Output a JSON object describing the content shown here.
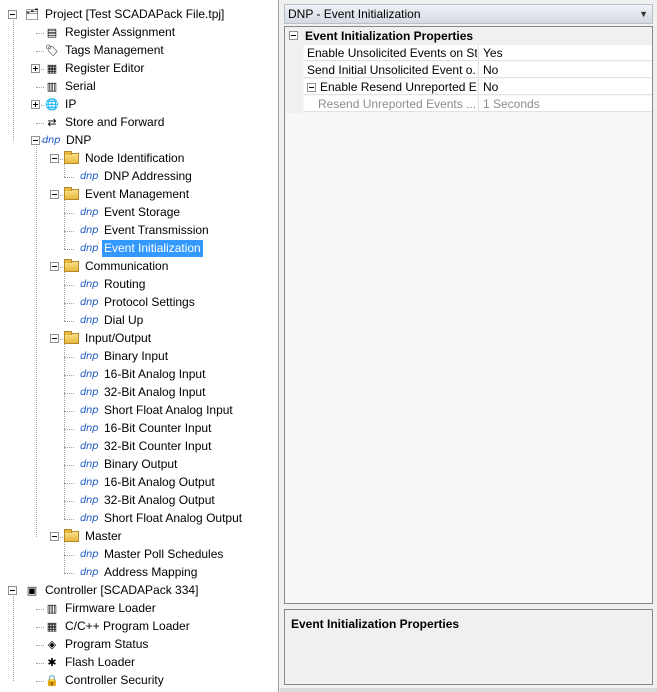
{
  "tree": {
    "items": [
      {
        "label": "Project [Test SCADAPack File.tpj]",
        "icon": "project-icon",
        "expander": "expanded",
        "depth": 0
      },
      {
        "label": "Register Assignment",
        "icon": "register-assignment-icon",
        "depth": 1
      },
      {
        "label": "Tags Management",
        "icon": "tag-icon",
        "depth": 1
      },
      {
        "label": "Register Editor",
        "icon": "register-editor-icon",
        "expander": "collapsed",
        "depth": 1
      },
      {
        "label": "Serial",
        "icon": "serial-icon",
        "depth": 1
      },
      {
        "label": "IP",
        "icon": "globe-icon",
        "expander": "collapsed",
        "depth": 1
      },
      {
        "label": "Store and Forward",
        "icon": "store-forward-icon",
        "depth": 1
      },
      {
        "label": "DNP",
        "icon": "dnp-icon",
        "expander": "expanded",
        "depth": 1
      },
      {
        "label": "Node Identification",
        "icon": "folder-icon",
        "expander": "expanded",
        "depth": 2
      },
      {
        "label": "DNP Addressing",
        "icon": "dnp-icon",
        "depth": 3
      },
      {
        "label": "Event Management",
        "icon": "folder-icon",
        "expander": "expanded",
        "depth": 2
      },
      {
        "label": "Event Storage",
        "icon": "dnp-icon",
        "depth": 3
      },
      {
        "label": "Event Transmission",
        "icon": "dnp-icon",
        "depth": 3
      },
      {
        "label": "Event Initialization",
        "icon": "dnp-icon",
        "depth": 3,
        "selected": true
      },
      {
        "label": "Communication",
        "icon": "folder-icon",
        "expander": "expanded",
        "depth": 2
      },
      {
        "label": "Routing",
        "icon": "dnp-icon",
        "depth": 3
      },
      {
        "label": "Protocol Settings",
        "icon": "dnp-icon",
        "depth": 3
      },
      {
        "label": "Dial Up",
        "icon": "dnp-icon",
        "depth": 3
      },
      {
        "label": "Input/Output",
        "icon": "folder-icon",
        "expander": "expanded",
        "depth": 2
      },
      {
        "label": "Binary Input",
        "icon": "dnp-icon",
        "depth": 3
      },
      {
        "label": "16-Bit Analog Input",
        "icon": "dnp-icon",
        "depth": 3
      },
      {
        "label": "32-Bit Analog Input",
        "icon": "dnp-icon",
        "depth": 3
      },
      {
        "label": "Short Float Analog Input",
        "icon": "dnp-icon",
        "depth": 3
      },
      {
        "label": "16-Bit Counter Input",
        "icon": "dnp-icon",
        "depth": 3
      },
      {
        "label": "32-Bit Counter Input",
        "icon": "dnp-icon",
        "depth": 3
      },
      {
        "label": "Binary Output",
        "icon": "dnp-icon",
        "depth": 3
      },
      {
        "label": "16-Bit Analog Output",
        "icon": "dnp-icon",
        "depth": 3
      },
      {
        "label": "32-Bit Analog Output",
        "icon": "dnp-icon",
        "depth": 3
      },
      {
        "label": "Short Float Analog Output",
        "icon": "dnp-icon",
        "depth": 3
      },
      {
        "label": "Master",
        "icon": "folder-icon",
        "expander": "expanded",
        "depth": 2
      },
      {
        "label": "Master Poll Schedules",
        "icon": "dnp-icon",
        "depth": 3
      },
      {
        "label": "Address Mapping",
        "icon": "dnp-icon",
        "depth": 3
      },
      {
        "label": "Controller [SCADAPack 334]",
        "icon": "controller-icon",
        "expander": "expanded",
        "depth": 0
      },
      {
        "label": "Firmware Loader",
        "icon": "firmware-icon",
        "depth": 1
      },
      {
        "label": "C/C++ Program Loader",
        "icon": "program-loader-icon",
        "depth": 1
      },
      {
        "label": "Program Status",
        "icon": "program-status-icon",
        "depth": 1
      },
      {
        "label": "Flash Loader",
        "icon": "flash-icon",
        "depth": 1
      },
      {
        "label": "Controller Security",
        "icon": "lock-icon",
        "depth": 1
      }
    ]
  },
  "dnp_icon_text": "dnp",
  "right_header": {
    "title": "DNP - Event Initialization",
    "dropdown_glyph": "▼"
  },
  "property_grid": {
    "category": "Event Initialization Properties",
    "rows": [
      {
        "name": "Enable Unsolicited Events on St...",
        "value": "Yes"
      },
      {
        "name": "Send Initial Unsolicited Event o...",
        "value": "No"
      },
      {
        "name": "Enable Resend Unreported E...",
        "value": "No",
        "expander": "expanded"
      },
      {
        "name": "Resend Unreported Events ...",
        "value": "1 Seconds",
        "disabled": true,
        "indent": true
      }
    ]
  },
  "description": {
    "title": "Event Initialization Properties"
  },
  "colors": {
    "selection": "#3399ff",
    "dnp_icon": "#1b58c4"
  }
}
